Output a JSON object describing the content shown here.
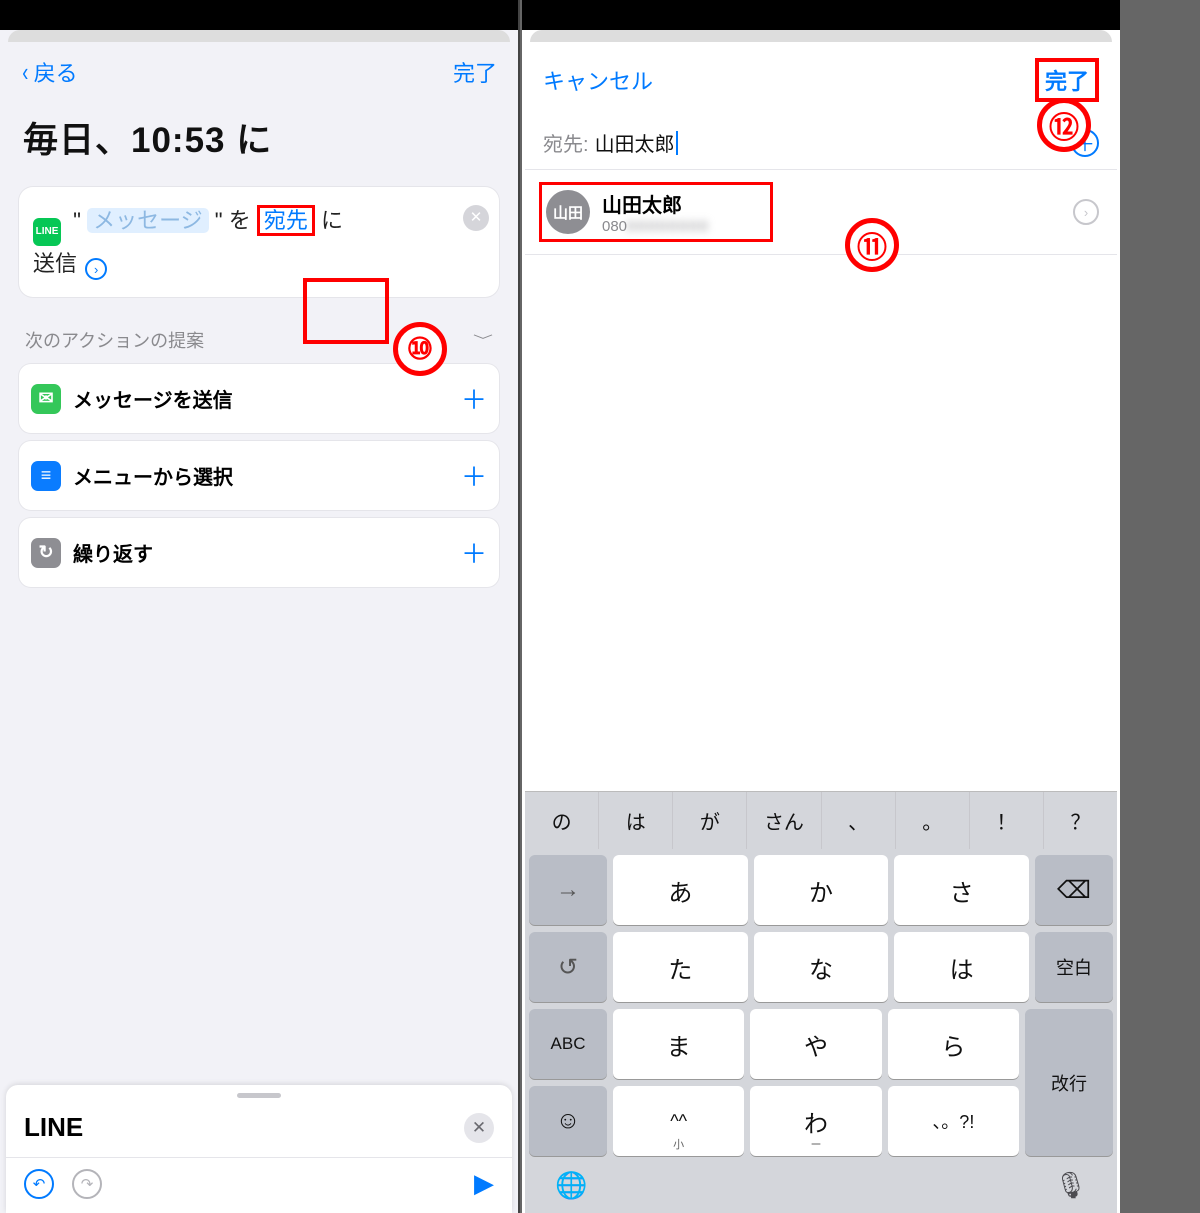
{
  "left": {
    "nav": {
      "back": "戻る",
      "done": "完了"
    },
    "title": "毎日、10:53 に",
    "action": {
      "quote_l": "\"",
      "message_placeholder": "メッセージ",
      "quote_r": "\"",
      "part_wo": " を ",
      "recipient": "宛先",
      "part_ni": " に",
      "send": "送信"
    },
    "suggestions": {
      "header": "次のアクションの提案",
      "items": [
        {
          "label": "メッセージを送信",
          "icon": "green-message",
          "glyph": "✉"
        },
        {
          "label": "メニューから選択",
          "icon": "blue-menu",
          "glyph": "≡"
        },
        {
          "label": "繰り返す",
          "icon": "gray-repeat",
          "glyph": "↻"
        }
      ]
    },
    "panel": {
      "app": "LINE"
    }
  },
  "right": {
    "nav": {
      "cancel": "キャンセル",
      "done": "完了"
    },
    "to": {
      "label": "宛先:",
      "value": "山田太郎"
    },
    "contact": {
      "avatar": "山田",
      "name": "山田太郎",
      "phone": "080"
    },
    "predictive": [
      "の",
      "は",
      "が",
      "さん",
      "、",
      "。",
      "！",
      "？"
    ],
    "keyboard": {
      "rows": [
        {
          "side_l": "→",
          "keys": [
            "あ",
            "か",
            "さ"
          ],
          "side_r": "⌫"
        },
        {
          "side_l": "↺",
          "keys": [
            "た",
            "な",
            "は"
          ],
          "side_r": "空白"
        },
        {
          "side_l": "ABC",
          "keys": [
            "ま",
            "や",
            "ら"
          ],
          "side_r_tall": "改行"
        },
        {
          "side_l": "☺",
          "keys": [
            "^^",
            "わ",
            "、。?!"
          ]
        }
      ],
      "globe": "🌐",
      "mic": "🎤"
    }
  },
  "annotations": {
    "n10": "⑩",
    "n11": "⑪",
    "n12": "⑫"
  }
}
